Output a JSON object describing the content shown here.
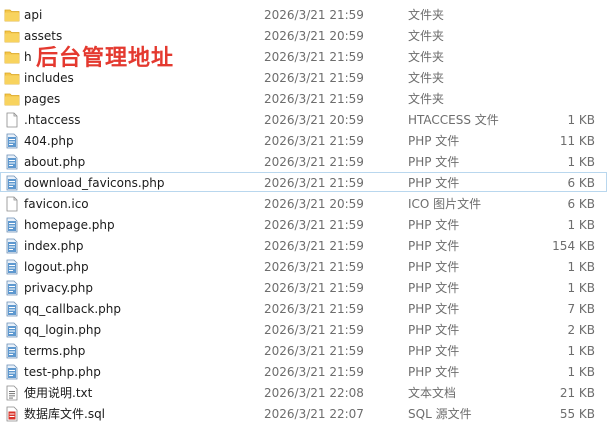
{
  "overlay_text": "后台管理地址",
  "colors": {
    "folder": "#f5c64a",
    "php_blue": "#3b82c4",
    "selected_border": "#b9d7ee",
    "overlay_red": "#e4392f"
  },
  "files": [
    {
      "name": "api",
      "date": "2026/3/21 21:59",
      "type": "文件夹",
      "size": "",
      "icon": "folder-icon"
    },
    {
      "name": "assets",
      "date": "2026/3/21 20:59",
      "type": "文件夹",
      "size": "",
      "icon": "folder-icon"
    },
    {
      "name": "h",
      "date": "2026/3/21 21:59",
      "type": "文件夹",
      "size": "",
      "icon": "folder-icon"
    },
    {
      "name": "includes",
      "date": "2026/3/21 21:59",
      "type": "文件夹",
      "size": "",
      "icon": "folder-icon"
    },
    {
      "name": "pages",
      "date": "2026/3/21 21:59",
      "type": "文件夹",
      "size": "",
      "icon": "folder-icon"
    },
    {
      "name": ".htaccess",
      "date": "2026/3/21 20:59",
      "type": "HTACCESS 文件",
      "size": "1 KB",
      "icon": "blank-file-icon"
    },
    {
      "name": "404.php",
      "date": "2026/3/21 21:59",
      "type": "PHP 文件",
      "size": "11 KB",
      "icon": "php-file-icon"
    },
    {
      "name": "about.php",
      "date": "2026/3/21 21:59",
      "type": "PHP 文件",
      "size": "1 KB",
      "icon": "php-file-icon"
    },
    {
      "name": "download_favicons.php",
      "date": "2026/3/21 21:59",
      "type": "PHP 文件",
      "size": "6 KB",
      "icon": "php-file-icon",
      "selected": true
    },
    {
      "name": "favicon.ico",
      "date": "2026/3/21 20:59",
      "type": "ICO 图片文件",
      "size": "6 KB",
      "icon": "blank-file-icon"
    },
    {
      "name": "homepage.php",
      "date": "2026/3/21 21:59",
      "type": "PHP 文件",
      "size": "1 KB",
      "icon": "php-file-icon"
    },
    {
      "name": "index.php",
      "date": "2026/3/21 21:59",
      "type": "PHP 文件",
      "size": "154 KB",
      "icon": "php-file-icon"
    },
    {
      "name": "logout.php",
      "date": "2026/3/21 21:59",
      "type": "PHP 文件",
      "size": "1 KB",
      "icon": "php-file-icon"
    },
    {
      "name": "privacy.php",
      "date": "2026/3/21 21:59",
      "type": "PHP 文件",
      "size": "1 KB",
      "icon": "php-file-icon"
    },
    {
      "name": "qq_callback.php",
      "date": "2026/3/21 21:59",
      "type": "PHP 文件",
      "size": "7 KB",
      "icon": "php-file-icon"
    },
    {
      "name": "qq_login.php",
      "date": "2026/3/21 21:59",
      "type": "PHP 文件",
      "size": "2 KB",
      "icon": "php-file-icon"
    },
    {
      "name": "terms.php",
      "date": "2026/3/21 21:59",
      "type": "PHP 文件",
      "size": "1 KB",
      "icon": "php-file-icon"
    },
    {
      "name": "test-php.php",
      "date": "2026/3/21 21:59",
      "type": "PHP 文件",
      "size": "1 KB",
      "icon": "php-file-icon"
    },
    {
      "name": "使用说明.txt",
      "date": "2026/3/21 22:08",
      "type": "文本文档",
      "size": "21 KB",
      "icon": "text-file-icon"
    },
    {
      "name": "数据库文件.sql",
      "date": "2026/3/21 22:07",
      "type": "SQL 源文件",
      "size": "55 KB",
      "icon": "sql-file-icon"
    }
  ]
}
